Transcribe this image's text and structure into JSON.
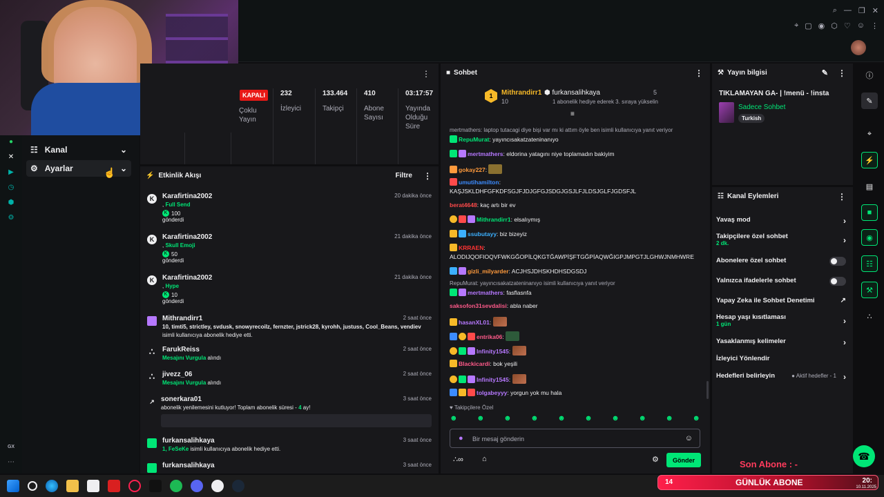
{
  "nav": {
    "items": [
      {
        "label": "Kanal"
      },
      {
        "label": "Ayarlar"
      }
    ]
  },
  "left_strip_bottom": {
    "gx": "GX"
  },
  "stats": {
    "status_badge": "KAPALI",
    "status_label": "Çoklu Yayın",
    "viewers": {
      "value": "232",
      "label": "İzleyici"
    },
    "followers": {
      "value": "133.464",
      "label": "Takipçi"
    },
    "subs": {
      "value": "410",
      "label": "Abone Sayısı"
    },
    "uptime": {
      "value": "03:17:57",
      "label": "Yayında Olduğu Süre"
    }
  },
  "events": {
    "title": "Etkinlik Akışı",
    "filter": "Filtre",
    "items": [
      {
        "name": "Karafirtina2002",
        "time": "20 dakika önce",
        "l2a": ", ",
        "l2b": "Full Send",
        "amount": "100",
        "l4": "gönderdi"
      },
      {
        "name": "Karafirtina2002",
        "time": "21 dakika önce",
        "l2a": ", ",
        "l2b": "Skull Emoji",
        "amount": "50",
        "l4": "gönderdi"
      },
      {
        "name": "Karafirtina2002",
        "time": "21 dakika önce",
        "l2a": ", ",
        "l2b": "Hype",
        "amount": "10",
        "l4": "gönderdi"
      },
      {
        "name": "Mithrandirr1",
        "time": "2 saat önce",
        "list": "10, timti5, strictley, svdusk, snowyrecoilz, fernzter, jstrick28, kyrohh, justuss, Cool_Beans, vendiev",
        "tail": "isimli kullanıcıya abonelik hediye etti."
      },
      {
        "name": "FarukReiss",
        "time": "2 saat önce",
        "hl": "Mesajını Vurgula",
        "rest": " alındı"
      },
      {
        "name": "jivezz_06",
        "time": "2 saat önce",
        "hl": "Mesajını Vurgula",
        "rest": " alındı"
      },
      {
        "name": "sonerkara01",
        "time": "3 saat önce",
        "text": "abonelik yenilemesini kutluyor! Toplam abonelik süresi - ",
        "months": "4",
        "unit": " ay!"
      },
      {
        "name": "furkansalihkaya",
        "time": "3 saat önce",
        "list": "1, FeSeKe",
        "tail": " isimli kullanıcıya abonelik hediye etti."
      },
      {
        "name": "furkansalihkaya",
        "time": "3 saat önce"
      }
    ]
  },
  "chat": {
    "title": "Sohbet",
    "hype": {
      "user": "Mithrandirr1",
      "count": "10",
      "user2": "furkansalihkaya",
      "count2": "5",
      "note": "1 abonelik hediye ederek 3. sıraya yükselin"
    },
    "lines": [
      {
        "reply": "mertmathers: laptop tutacagi diye bişi var mı ki attım öyle ben isimli kullanıcıya yanıt veriyor"
      },
      {
        "user": "RepuMurat",
        "color": "#00e676",
        "msg": ": yayıncısakatzateninanıyo"
      },
      {
        "user": "mertmathers",
        "color": "#b678ff",
        "msg": ": eldorina yatagını niye toplamadın bakiyim"
      },
      {
        "user": "gokay227",
        "color": "#ff9a3c",
        "msg": ": "
      },
      {
        "user": "umutihamilton",
        "color": "#3c8cff",
        "msg": ":"
      },
      {
        "msg": "KAŞJSKLDHFGFKDFSGJFJDJGFGJSDGJGSJLFJLDSJGLFJGDSFJL"
      },
      {
        "user": "berat4648",
        "color": "#ff4a4a",
        "msg": ": kaç artı bir ev"
      },
      {
        "user": "Mithrandirr1",
        "color": "#00e676",
        "msg": ": elsalıymış"
      },
      {
        "user": "ssubutayy",
        "color": "#3cb0ff",
        "msg": ": biz bizeyiz"
      },
      {
        "user": "KRRAEN",
        "color": "#ff3333",
        "msg": ":"
      },
      {
        "msg": "ALODIJQOFIOQVFWKGĞOPİLQKGTĞAWPİŞFTGĞPİAQWĞIGPJMPGTJLGHWJNMHWRE"
      },
      {
        "user": "gizli_milyarder",
        "color": "#ff9a3c",
        "msg": ": ACJHSJDHSKHDHSDGSDJ"
      },
      {
        "reply": "RepuMurat: yayıncısakatzateninanıyo isimli kullanıcıya yanıt veriyor"
      },
      {
        "user": "mertmathers",
        "color": "#b678ff",
        "msg": ": fasflasnfa"
      },
      {
        "user": "saksofon31sevdalisi",
        "color": "#ff5a8a",
        "msg": ": abla naber"
      },
      {
        "user": "hasanXL01",
        "color": "#b678ff",
        "msg": ": "
      },
      {
        "user": "entrika06",
        "color": "#ff5a8a",
        "msg": ": "
      },
      {
        "user": "Infinity1545",
        "color": "#b678ff",
        "msg": ": "
      },
      {
        "user": "Blackicardi",
        "color": "#ff5a8a",
        "msg": ": bok yeşili"
      },
      {
        "user": "Infinity1545",
        "color": "#b678ff",
        "msg": ": "
      },
      {
        "user": "tolgabeyyy",
        "color": "#b678ff",
        "msg": ": yorgun yok mu hala"
      }
    ],
    "follower_only": "Takipçilere Özel",
    "placeholder": "Bir mesaj gönderin",
    "send": "Gönder"
  },
  "stream_info": {
    "title": "Yayın bilgisi",
    "stream_title": "TIKLAMAYAN GA- | !menü - !insta",
    "category": "Sadece Sohbet",
    "tag": "Turkish"
  },
  "actions": {
    "title": "Kanal Eylemleri",
    "items": [
      {
        "label": "Yavaş mod"
      },
      {
        "label": "Takipçilere özel sohbet",
        "sub": "2 dk."
      },
      {
        "label": "Abonelere özel sohbet"
      },
      {
        "label": "Yalnızca ifadelerle sohbet"
      },
      {
        "label": "Yapay Zeka ile Sohbet Denetimi"
      },
      {
        "label": "Hesap yaşı kısıtlaması",
        "sub": "1 gün"
      },
      {
        "label": "Yasaklanmış kelimeler"
      },
      {
        "label": "İzleyici Yönlendir"
      },
      {
        "label": "Hedefleri belirleyin",
        "extra": "Aktif hedefler - 1"
      }
    ]
  },
  "overlay": {
    "son_abone": "Son Abone : -",
    "goal_count": "14",
    "goal_label": "GÜNLÜK ABONE",
    "clock": "20:",
    "date": "10.11.2025"
  },
  "colors": {
    "accent": "#00e676",
    "badge_red": "#e91916",
    "bg": "#0e0e10",
    "panel": "#18181b"
  }
}
